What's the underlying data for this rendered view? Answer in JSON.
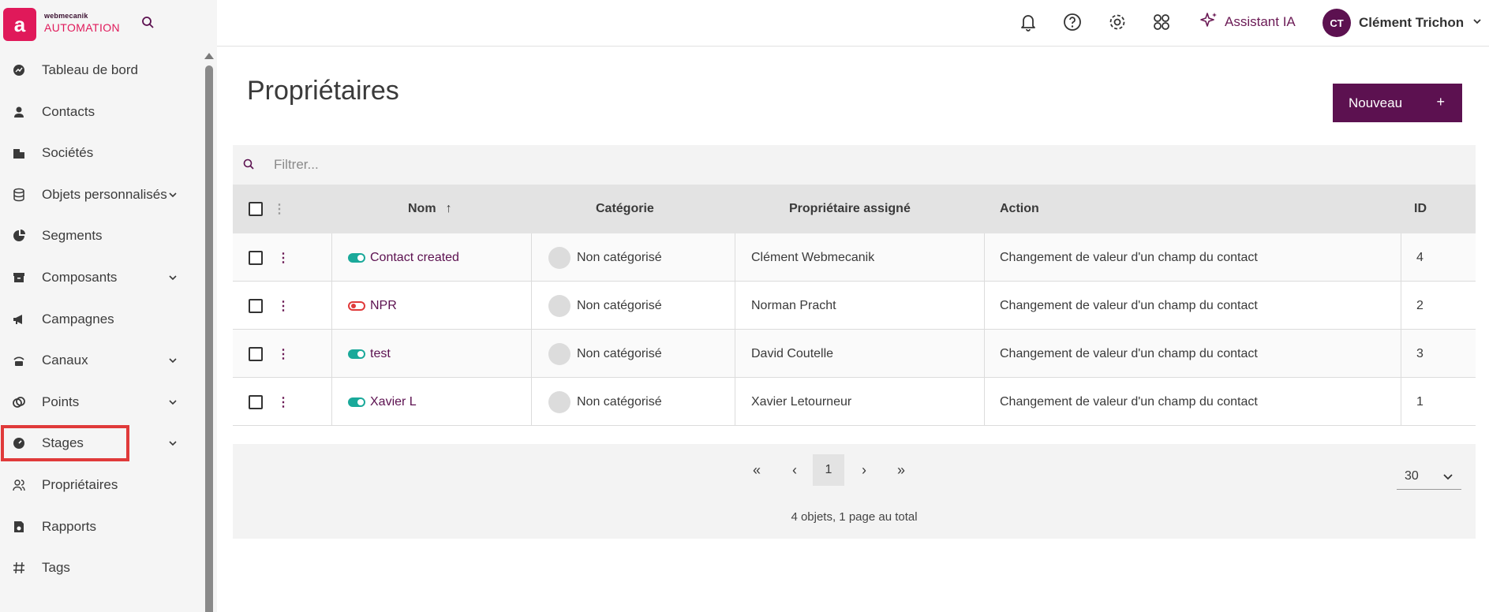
{
  "brand": {
    "small": "webmecanik",
    "big": "AUTOMATION",
    "logo_letter": "a"
  },
  "header": {
    "icons": [
      "bell-icon",
      "help-icon",
      "gear-icon",
      "apps-icon"
    ],
    "assistant_label": "Assistant IA",
    "user_initials": "CT",
    "user_name": "Clément Trichon"
  },
  "sidebar": {
    "items": [
      {
        "label": "Tableau de bord",
        "icon": "dashboard-icon",
        "chevron": false
      },
      {
        "label": "Contacts",
        "icon": "person-icon",
        "chevron": false
      },
      {
        "label": "Sociétés",
        "icon": "building-icon",
        "chevron": false
      },
      {
        "label": "Objets personnalisés",
        "icon": "database-icon",
        "chevron": true
      },
      {
        "label": "Segments",
        "icon": "pie-chart-icon",
        "chevron": false
      },
      {
        "label": "Composants",
        "icon": "archive-icon",
        "chevron": true
      },
      {
        "label": "Campagnes",
        "icon": "megaphone-icon",
        "chevron": false
      },
      {
        "label": "Canaux",
        "icon": "channel-icon",
        "chevron": true
      },
      {
        "label": "Points",
        "icon": "points-icon",
        "chevron": true
      },
      {
        "label": "Stages",
        "icon": "gauge-icon",
        "chevron": true
      },
      {
        "label": "Propriétaires",
        "icon": "users-icon",
        "chevron": false,
        "active": true
      },
      {
        "label": "Rapports",
        "icon": "report-icon",
        "chevron": false
      },
      {
        "label": "Tags",
        "icon": "hash-icon",
        "chevron": false
      }
    ]
  },
  "main": {
    "title": "Propriétaires",
    "new_button": "Nouveau",
    "new_button_plus": "+",
    "filter_placeholder": "Filtrer...",
    "columns": {
      "name": "Nom",
      "name_sort": "↑",
      "category": "Catégorie",
      "owner": "Propriétaire assigné",
      "action": "Action",
      "id": "ID"
    },
    "rows": [
      {
        "name": "Contact created",
        "active": true,
        "category": "Non catégorisé",
        "owner": "Clément Webmecanik",
        "action": "Changement de valeur d'un champ du contact",
        "id": "4"
      },
      {
        "name": "NPR",
        "active": false,
        "category": "Non catégorisé",
        "owner": "Norman Pracht",
        "action": "Changement de valeur d'un champ du contact",
        "id": "2"
      },
      {
        "name": "test",
        "active": true,
        "category": "Non catégorisé",
        "owner": "David Coutelle",
        "action": "Changement de valeur d'un champ du contact",
        "id": "3"
      },
      {
        "name": "Xavier L",
        "active": true,
        "category": "Non catégorisé",
        "owner": "Xavier Letourneur",
        "action": "Changement de valeur d'un champ du contact",
        "id": "1"
      }
    ],
    "pagination": {
      "first": "«",
      "prev": "‹",
      "current": "1",
      "next": "›",
      "last": "»",
      "summary": "4 objets, 1 page au total",
      "per_page": "30"
    }
  },
  "colors": {
    "brand": "#e0195a",
    "accent": "#5c1150",
    "active_on": "#1aa99a",
    "active_off": "#e03a3a"
  }
}
